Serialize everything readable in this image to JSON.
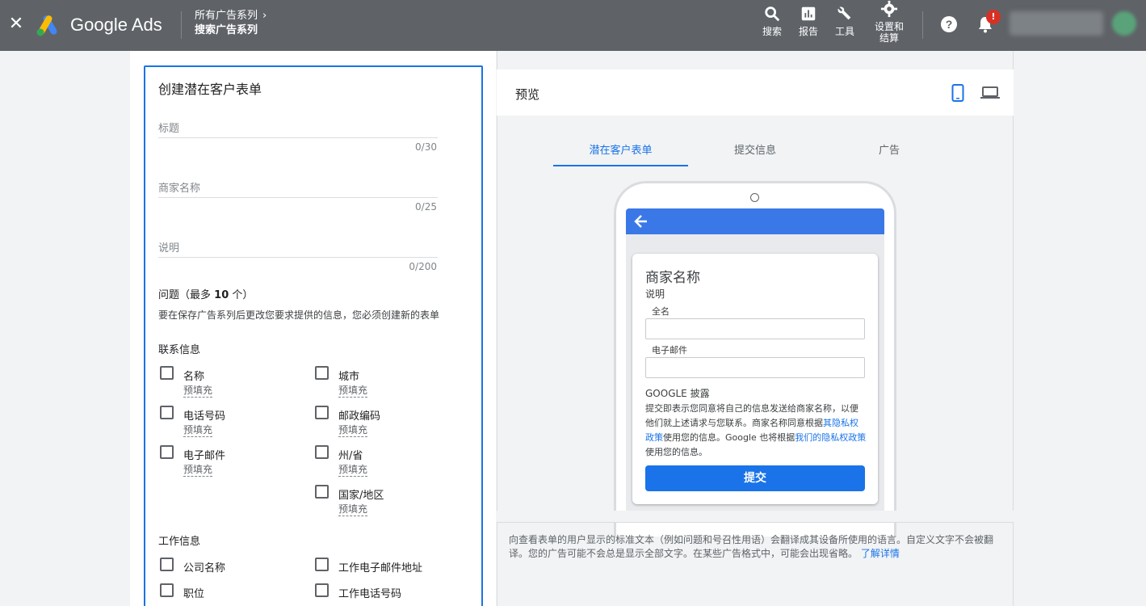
{
  "topbar": {
    "close_icon": "close-icon",
    "brand": "Google Ads",
    "breadcrumb_parent": "所有广告系列",
    "breadcrumb_current": "搜索广告系列",
    "tools": [
      {
        "icon": "search-icon",
        "label": "搜索"
      },
      {
        "icon": "bar-chart-icon",
        "label": "报告"
      },
      {
        "icon": "wrench-icon",
        "label": "工具"
      },
      {
        "icon": "gear-icon",
        "label_line1": "设置和",
        "label_line2": "结算"
      }
    ],
    "notification_badge": "!"
  },
  "form": {
    "title": "创建潜在客户表单",
    "fields": [
      {
        "label": "标题",
        "counter": "0/30"
      },
      {
        "label": "商家名称",
        "counter": "0/25"
      },
      {
        "label": "说明",
        "counter": "0/200"
      }
    ],
    "questions_title": "问题（最多",
    "questions_count": "10",
    "questions_suffix": "个）",
    "questions_note": "要在保存广告系列后更改您要求提供的信息，您必须创建新的表单",
    "contact_section": "联系信息",
    "contact_left": [
      {
        "label": "名称",
        "prefill": "预填充"
      },
      {
        "label": "电话号码",
        "prefill": "预填充"
      },
      {
        "label": "电子邮件",
        "prefill": "预填充"
      }
    ],
    "contact_right": [
      {
        "label": "城市",
        "prefill": "预填充"
      },
      {
        "label": "邮政编码",
        "prefill": "预填充"
      },
      {
        "label": "州/省",
        "prefill": "预填充"
      },
      {
        "label": "国家/地区",
        "prefill": "预填充"
      }
    ],
    "work_section": "工作信息",
    "work_left": [
      "公司名称",
      "职位"
    ],
    "work_right": [
      "工作电子邮件地址",
      "工作电话号码"
    ]
  },
  "preview": {
    "title": "预览",
    "tabs": [
      "潜在客户表单",
      "提交信息",
      "广告"
    ],
    "active_tab": 0,
    "card": {
      "business_name": "商家名称",
      "description": "说明",
      "field1": "全名",
      "field2": "电子邮件",
      "disclosure_title": "GOOGLE 披露",
      "disclosure_part1": "提交即表示您同意将自己的信息发送给商家名称，以便他们就上述请求与您联系。商家名称同意根据",
      "disclosure_link1": "其隐私权政策",
      "disclosure_part2": "使用您的信息。Google 也将根据",
      "disclosure_link2": "我们的隐私权政策",
      "disclosure_part3": "使用您的信息。",
      "submit": "提交"
    },
    "footnote": "向查看表单的用户显示的标准文本（例如问题和号召性用语）会翻译成其设备所使用的语言。自定义文字不会被翻译。您的广告可能不会总是显示全部文字。在某些广告格式中，可能会出现省略。",
    "footnote_link": "了解详情"
  },
  "colors": {
    "accent": "#1a73e8",
    "topbar": "#5f6368",
    "appbar": "#3b78e7",
    "badge": "#d93025"
  }
}
